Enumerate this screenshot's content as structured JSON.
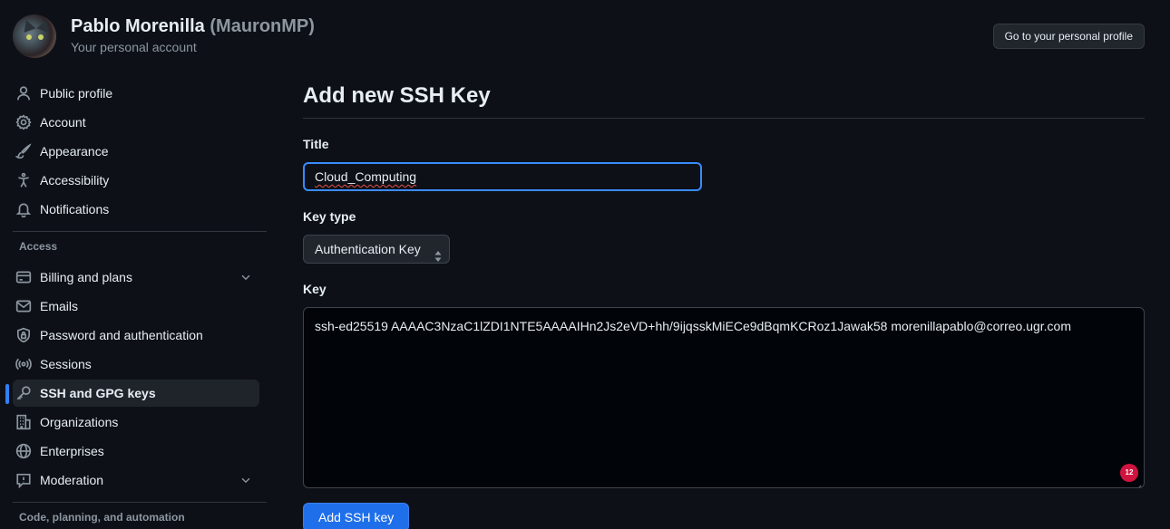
{
  "header": {
    "name": "Pablo Morenilla",
    "login": "(MauronMP)",
    "subtitle": "Your personal account",
    "profile_button": "Go to your personal profile"
  },
  "sidebar": {
    "items": [
      {
        "label": "Public profile",
        "icon": "person-icon"
      },
      {
        "label": "Account",
        "icon": "gear-icon"
      },
      {
        "label": "Appearance",
        "icon": "paintbrush-icon"
      },
      {
        "label": "Accessibility",
        "icon": "accessibility-icon"
      },
      {
        "label": "Notifications",
        "icon": "bell-icon"
      }
    ],
    "access_title": "Access",
    "access_items": [
      {
        "label": "Billing and plans",
        "icon": "credit-card-icon",
        "expandable": true
      },
      {
        "label": "Emails",
        "icon": "mail-icon"
      },
      {
        "label": "Password and authentication",
        "icon": "shield-lock-icon"
      },
      {
        "label": "Sessions",
        "icon": "broadcast-icon"
      },
      {
        "label": "SSH and GPG keys",
        "icon": "key-icon",
        "active": true
      },
      {
        "label": "Organizations",
        "icon": "organization-icon"
      },
      {
        "label": "Enterprises",
        "icon": "globe-icon"
      },
      {
        "label": "Moderation",
        "icon": "report-icon",
        "expandable": true
      }
    ],
    "next_section_title": "Code, planning, and automation"
  },
  "main": {
    "page_title": "Add new SSH Key",
    "title_label": "Title",
    "title_value": "Cloud_Computing",
    "key_type_label": "Key type",
    "key_type_value": "Authentication Key",
    "key_label": "Key",
    "key_value": "ssh-ed25519 AAAAC3NzaC1lZDI1NTE5AAAAIHn2Js2eVD+hh/9ijqsskMiECe9dBqmKCRoz1Jawak58 morenillapablo@correo.ugr.com",
    "counter_badge": "12",
    "submit_button": "Add SSH key"
  },
  "colors": {
    "background": "#0d1117",
    "accent": "#1f6feb",
    "active_indicator": "#2f81f7",
    "focus_border": "#3a8bfd",
    "badge": "#d1133f"
  }
}
